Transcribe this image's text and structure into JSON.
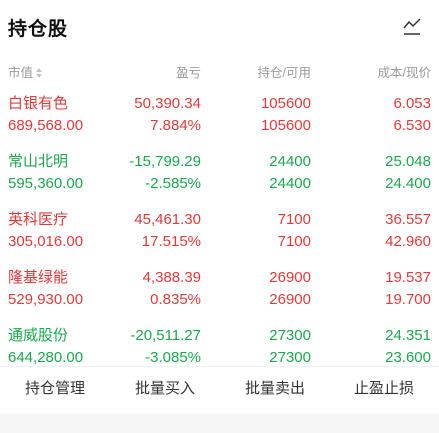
{
  "title": "持仓股",
  "header": {
    "market_value": "市值",
    "profit_loss": "盈亏",
    "position": "持仓/可用",
    "cost": "成本/现价"
  },
  "holdings": [
    {
      "name": "白银有色",
      "market_value": "689,568.00",
      "pl_amount": "50,390.34",
      "pl_percent": "7.884%",
      "holding": "105600",
      "available": "105600",
      "cost": "6.053",
      "price": "6.530",
      "trend": "up"
    },
    {
      "name": "常山北明",
      "market_value": "595,360.00",
      "pl_amount": "-15,799.29",
      "pl_percent": "-2.585%",
      "holding": "24400",
      "available": "24400",
      "cost": "25.048",
      "price": "24.400",
      "trend": "down"
    },
    {
      "name": "英科医疗",
      "market_value": "305,016.00",
      "pl_amount": "45,461.30",
      "pl_percent": "17.515%",
      "holding": "7100",
      "available": "7100",
      "cost": "36.557",
      "price": "42.960",
      "trend": "up"
    },
    {
      "name": "隆基绿能",
      "market_value": "529,930.00",
      "pl_amount": "4,388.39",
      "pl_percent": "0.835%",
      "holding": "26900",
      "available": "26900",
      "cost": "19.537",
      "price": "19.700",
      "trend": "up"
    },
    {
      "name": "通威股份",
      "market_value": "644,280.00",
      "pl_amount": "-20,511.27",
      "pl_percent": "-3.085%",
      "holding": "27300",
      "available": "27300",
      "cost": "24.351",
      "price": "23.600",
      "trend": "down"
    }
  ],
  "actions": {
    "manage": "持仓管理",
    "batch_buy": "批量买入",
    "batch_sell": "批量卖出",
    "stop_profit_loss": "止盈止损"
  },
  "colors": {
    "up": "#e23a3a",
    "down": "#1aa84c"
  },
  "icons": {
    "chart": "line-chart-icon",
    "sort": "sort-icon"
  }
}
